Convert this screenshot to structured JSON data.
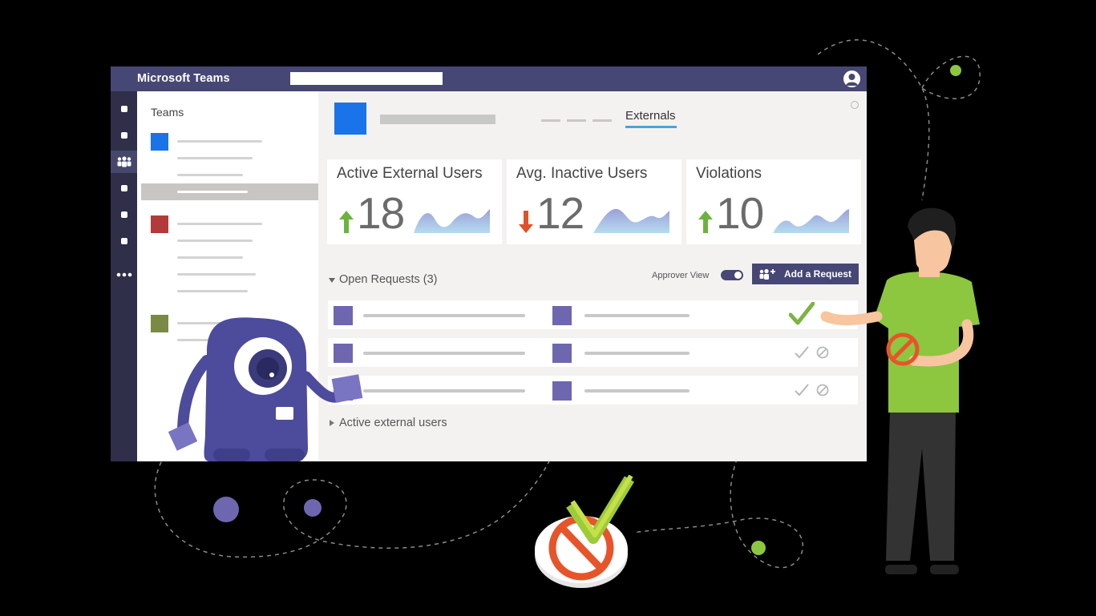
{
  "app": {
    "title": "Microsoft Teams",
    "search_value": ""
  },
  "rail": {
    "items": [
      "square-icon",
      "square-icon",
      "teams-icon",
      "square-icon",
      "square-icon",
      "square-icon",
      "more-icon"
    ],
    "active_index": 2
  },
  "teams_panel": {
    "title": "Teams",
    "team_colors": [
      "#1a73e8",
      "#b33a3a",
      "#7a8a45"
    ]
  },
  "header": {
    "tab_label": "Externals",
    "accent_color": "#4aa3df"
  },
  "cards": [
    {
      "title": "Active External Users",
      "value": "18",
      "trend": "up",
      "trend_color": "#6cb33e"
    },
    {
      "title": "Avg. Inactive Users",
      "value": "12",
      "trend": "down",
      "trend_color": "#e0512a"
    },
    {
      "title": "Violations",
      "value": "10",
      "trend": "up",
      "trend_color": "#6cb33e"
    }
  ],
  "requests": {
    "section_label": "Open Requests (3)",
    "approver_view_label": "Approver View",
    "approver_view_on": true,
    "add_button_label": "Add a Request",
    "rows": [
      {
        "approved": true
      },
      {
        "approved": false
      },
      {
        "approved": false
      }
    ]
  },
  "active_external": {
    "section_label": "Active external users"
  },
  "colors": {
    "titlebar": "#464775",
    "rail": "#2f2f4a",
    "request_square": "#6e67b0",
    "approve_green": "#7cb342",
    "block_orange": "#e8542a"
  }
}
